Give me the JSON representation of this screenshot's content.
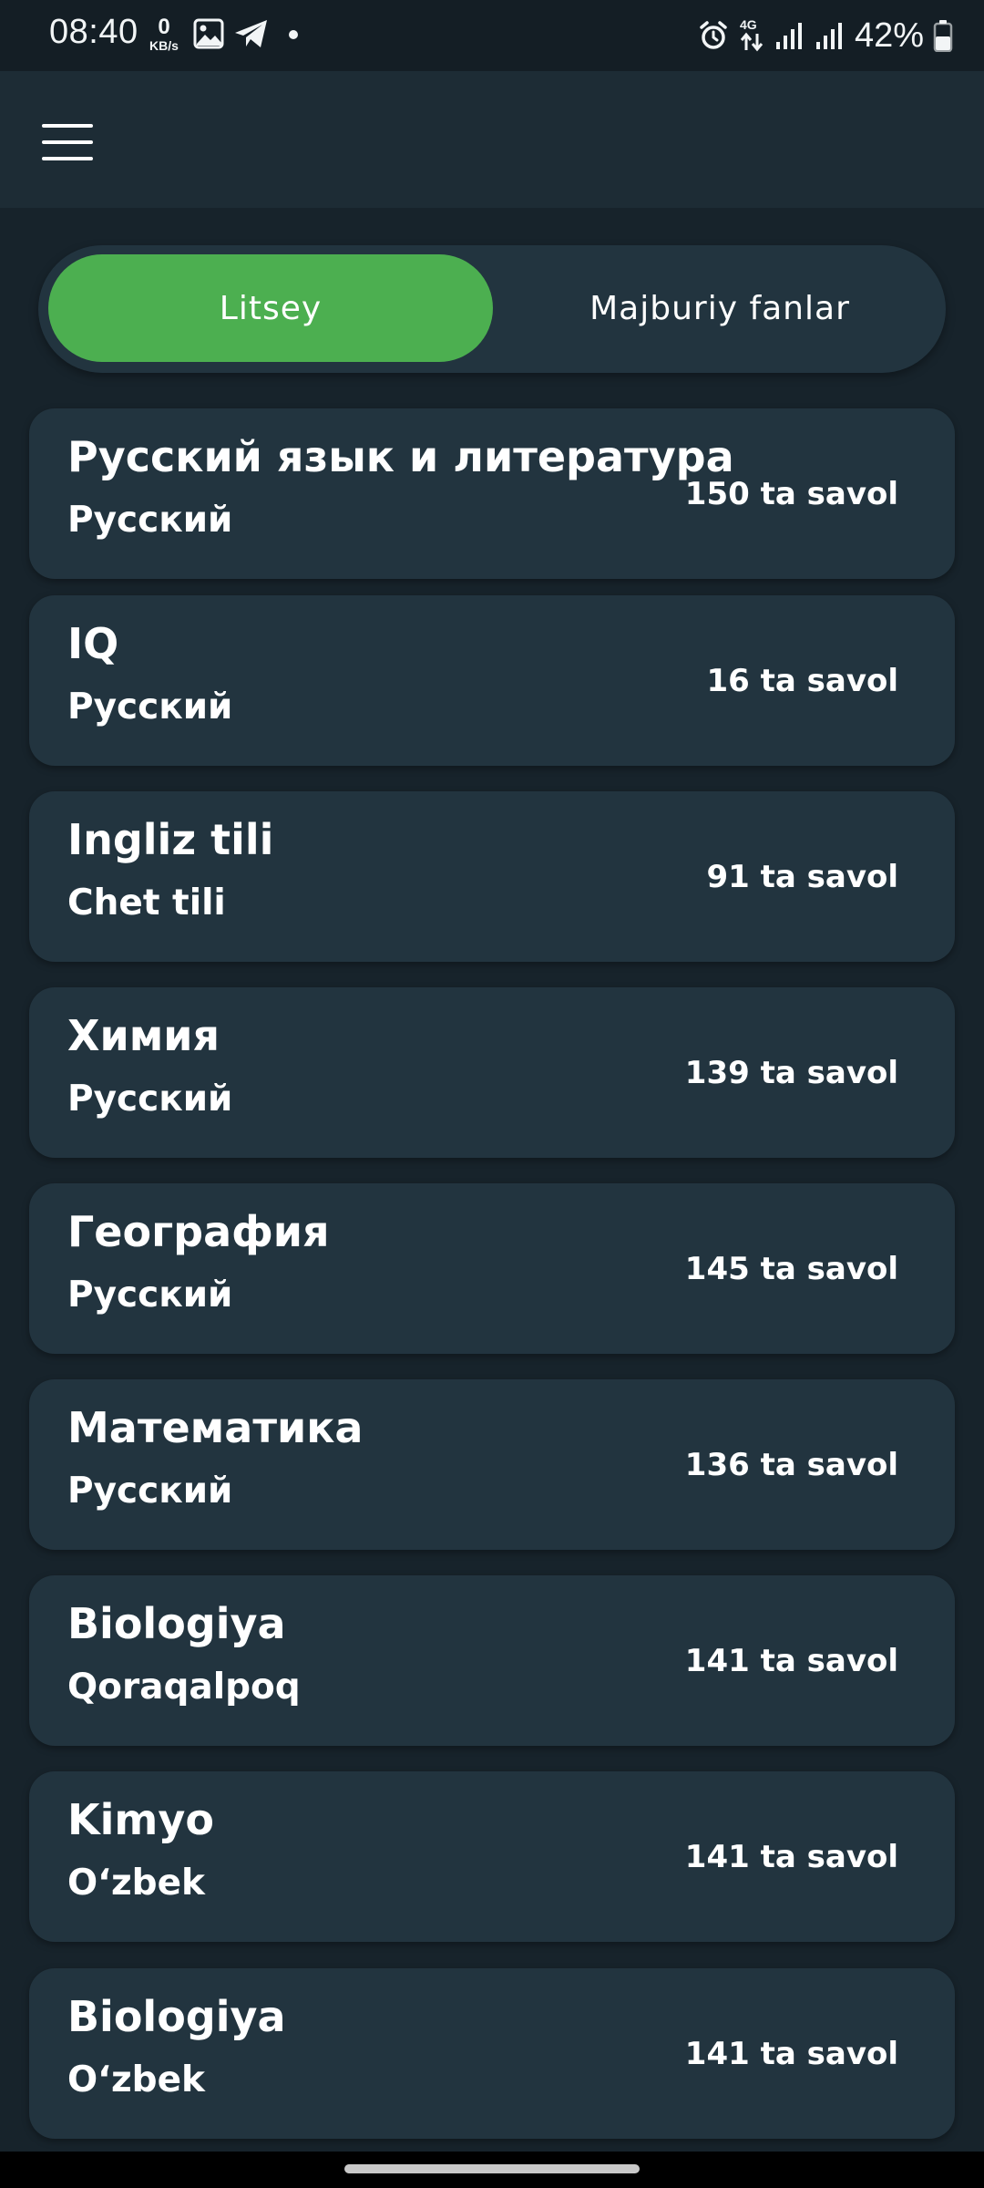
{
  "status_bar": {
    "time": "08:40",
    "net_speed_value": "0",
    "net_speed_unit": "KB/s",
    "network_type": "4G",
    "battery_percent": "42%",
    "icons": [
      "gallery-icon",
      "telegram-icon",
      "dot-icon",
      "alarm-icon",
      "data-arrows-icon",
      "signal-icon",
      "signal-icon",
      "battery-icon"
    ]
  },
  "app_bar": {
    "menu_icon": "hamburger-menu-icon"
  },
  "tabs": [
    {
      "label": "Litsey",
      "active": true
    },
    {
      "label": "Majburiy fanlar",
      "active": false
    }
  ],
  "subjects": [
    {
      "title": "Русский язык и литература",
      "language": "Русский",
      "count": "150 ta savol"
    },
    {
      "title": "IQ",
      "language": "Русский",
      "count": "16 ta savol"
    },
    {
      "title": "Ingliz tili",
      "language": "Chet tili",
      "count": "91 ta savol"
    },
    {
      "title": "Химия",
      "language": "Русский",
      "count": "139 ta savol"
    },
    {
      "title": "География",
      "language": "Русский",
      "count": "145 ta savol"
    },
    {
      "title": "Математика",
      "language": "Русский",
      "count": "136 ta savol"
    },
    {
      "title": "Biologiya",
      "language": "Qoraqalpoq",
      "count": "141 ta savol"
    },
    {
      "title": "Kimyo",
      "language": "O‘zbek",
      "count": "141 ta savol"
    },
    {
      "title": "Biologiya",
      "language": "O‘zbek",
      "count": "141 ta savol"
    }
  ],
  "colors": {
    "background": "#17232b",
    "app_bar": "#1d2c35",
    "card": "#22343f",
    "accent_green": "#4caf50"
  }
}
